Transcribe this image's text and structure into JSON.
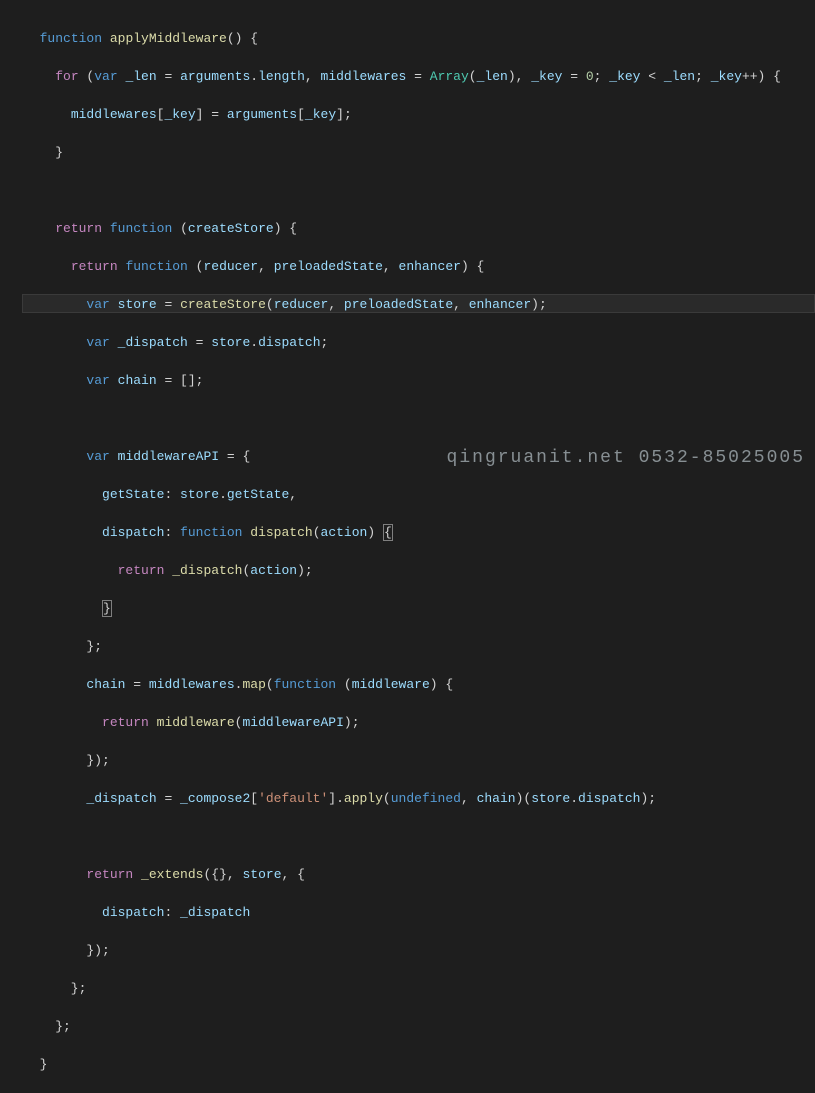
{
  "watermark": "qingruanit.net 0532-85025005",
  "tokens": {
    "fn": "function",
    "var": "var",
    "return": "return",
    "for": "for",
    "Array": "Array",
    "undefined": "undefined",
    "applyMiddleware": "applyMiddleware",
    "arguments": "arguments",
    "length": "length",
    "middlewares": "middlewares",
    "_len": "_len",
    "_key": "_key",
    "zero": "0",
    "createStore": "createStore",
    "reducer": "reducer",
    "preloadedState": "preloadedState",
    "enhancer": "enhancer",
    "store": "store",
    "_dispatch": "_dispatch",
    "dispatch": "dispatch",
    "chain": "chain",
    "middlewareAPI": "middlewareAPI",
    "getState": "getState",
    "action": "action",
    "map": "map",
    "middleware": "middleware",
    "_compose2": "_compose2",
    "default_str": "'default'",
    "apply": "apply",
    "_extends": "_extends"
  }
}
